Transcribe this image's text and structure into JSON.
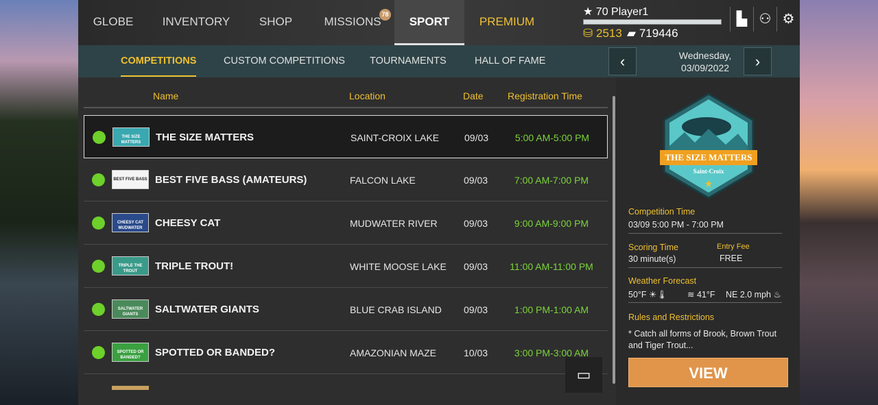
{
  "topnav": {
    "tabs": [
      {
        "label": "GLOBE"
      },
      {
        "label": "INVENTORY"
      },
      {
        "label": "SHOP"
      },
      {
        "label": "MISSIONS",
        "badge": "78"
      },
      {
        "label": "SPORT",
        "active": true
      },
      {
        "label": "PREMIUM"
      }
    ]
  },
  "player": {
    "level": "70",
    "name": "Player1",
    "gold": "2513",
    "credits": "719446",
    "xp_fraction": 0.0
  },
  "subnav": {
    "tabs": [
      {
        "label": "COMPETITIONS"
      },
      {
        "label": "CUSTOM COMPETITIONS"
      },
      {
        "label": "TOURNAMENTS"
      },
      {
        "label": "HALL OF FAME"
      }
    ],
    "date_line1": "Wednesday,",
    "date_line2": "03/09/2022"
  },
  "table": {
    "columns": [
      "Name",
      "Location",
      "Date",
      "Registration Time"
    ],
    "rows": [
      {
        "name": "THE SIZE MATTERS",
        "location": "SAINT-CROIX LAKE",
        "date": "09/03",
        "time": "5:00 AM-5:00 PM",
        "logo": "THE SIZE MATTERS",
        "logo_color": "#3aa8b0"
      },
      {
        "name": "BEST FIVE BASS (AMATEURS)",
        "location": "FALCON LAKE",
        "date": "09/03",
        "time": "7:00 AM-7:00 PM",
        "logo": "BEST FIVE BASS",
        "logo_color": "#f4f4f4"
      },
      {
        "name": "CHEESY CAT",
        "location": "MUDWATER RIVER",
        "date": "09/03",
        "time": "9:00 AM-9:00 PM",
        "logo": "CHEESY CAT MUDWATER",
        "logo_color": "#2a4a8a"
      },
      {
        "name": "TRIPLE TROUT!",
        "location": "WHITE MOOSE LAKE",
        "date": "09/03",
        "time": "11:00 AM-11:00 PM",
        "logo": "TRIPLE THE TROUT",
        "logo_color": "#3a9a8a"
      },
      {
        "name": "SALTWATER GIANTS",
        "location": "BLUE CRAB ISLAND",
        "date": "09/03",
        "time": "1:00 PM-1:00 AM",
        "logo": "SALTWATER GIANTS",
        "logo_color": "#4a8a5a"
      },
      {
        "name": "SPOTTED OR BANDED?",
        "location": "AMAZONIAN MAZE",
        "date": "10/03",
        "time": "3:00 PM-3:00 AM",
        "logo": "SPOTTED OR BANDED?",
        "logo_color": "#3aa040"
      }
    ]
  },
  "detail": {
    "emblem_title": "THE SIZE MATTERS",
    "emblem_sub": "Saint-Croix",
    "competition_time_label": "Competition Time",
    "competition_time": "03/09 5:00 PM - 7:00 PM",
    "scoring_time_label": "Scoring Time",
    "scoring_time": "30 minute(s)",
    "entry_fee_label": "Entry Fee",
    "entry_fee": "FREE",
    "weather_label": "Weather Forecast",
    "air_temp": "50°F",
    "water_temp": "41°F",
    "wind": "NE 2.0 mph",
    "rules_label": "Rules and Restrictions",
    "rules": "* Catch all forms of Brook, Brown Trout and Tiger Trout...",
    "view_label": "VIEW"
  }
}
